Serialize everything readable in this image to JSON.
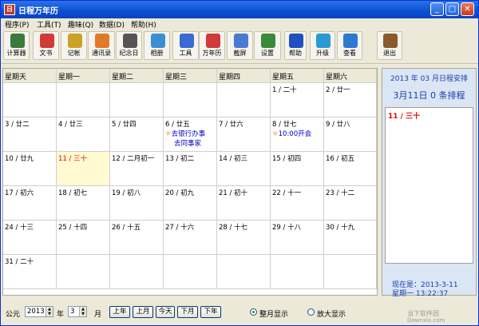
{
  "window": {
    "title": "日程万年历"
  },
  "menu": [
    "程序(P)",
    "工具(T)",
    "趣味(Q)",
    "数据(D)",
    "帮助(H)"
  ],
  "toolbar": [
    {
      "label": "计算器",
      "icon": "calculator-icon",
      "color": "#3a7a3a"
    },
    {
      "label": "文书",
      "icon": "document-icon",
      "color": "#d23a3a"
    },
    {
      "label": "记帐",
      "icon": "money-icon",
      "color": "#c9a227"
    },
    {
      "label": "通讯录",
      "icon": "addressbook-icon",
      "color": "#e07a2a"
    },
    {
      "label": "纪念日",
      "icon": "film-icon",
      "color": "#555555"
    },
    {
      "label": "相册",
      "icon": "photo-icon",
      "color": "#3a8fd2"
    },
    {
      "label": "工具",
      "icon": "magnifier-icon",
      "color": "#3a6ad2"
    },
    {
      "label": "万年历",
      "icon": "calendar-icon",
      "color": "#d23a3a"
    },
    {
      "label": "截屏",
      "icon": "screenshot-icon",
      "color": "#4a7ad2"
    },
    {
      "label": "设置",
      "icon": "settings-icon",
      "color": "#3a8a3a"
    },
    {
      "label": "帮助",
      "icon": "help-icon",
      "color": "#2050c0"
    },
    {
      "label": "升级",
      "icon": "upgrade-icon",
      "color": "#2a9ad2"
    },
    {
      "label": "查看",
      "icon": "globe-icon",
      "color": "#2a7ad2"
    },
    {
      "label": "退出",
      "icon": "exit-icon",
      "color": "#8a5a2a"
    }
  ],
  "weekdays": [
    "星期天",
    "星期一",
    "星期二",
    "星期三",
    "星期四",
    "星期五",
    "星期六"
  ],
  "weeks": [
    [
      "",
      "",
      "",
      "",
      "",
      "1 / 二十",
      "2 / 廿一"
    ],
    [
      "3 / 廿二",
      "4 / 廿三",
      "5 / 廿四",
      "6 / 廿五",
      "7 / 廿六",
      "8 / 廿七",
      "9 / 廿八"
    ],
    [
      "10 / 廿九",
      "11 / 三十",
      "12 / 二月初一",
      "13 / 初二",
      "14 / 初三",
      "15 / 初四",
      "16 / 初五"
    ],
    [
      "17 / 初六",
      "18 / 初七",
      "19 / 初八",
      "20 / 初九",
      "21 / 初十",
      "22 / 十一",
      "23 / 十二"
    ],
    [
      "24 / 十三",
      "25 / 十四",
      "26 / 十五",
      "27 / 十六",
      "28 / 十七",
      "29 / 十八",
      "30 / 十九"
    ],
    [
      "31 / 二十",
      "",
      "",
      "",
      "",
      "",
      ""
    ]
  ],
  "events": {
    "wed_week2": [
      "去银行办事",
      "去同事家"
    ],
    "fri_week2": [
      "10:00开会"
    ]
  },
  "today": "11 / 三十",
  "sidebar": {
    "header": "2013 年 03 月日程安排",
    "count": "3月11日 0 条排程",
    "selected": "11 / 三十",
    "now_label": "现在是：2013-3-11",
    "now_time": "星期一   13:22:37"
  },
  "bottom": {
    "era": "公元",
    "year": "2013",
    "year_unit": "年",
    "month": "3",
    "month_unit": "月",
    "buttons": [
      "上年",
      "上月",
      "今天",
      "下月",
      "下年"
    ],
    "radio1": "整月显示",
    "radio2": "放大显示"
  },
  "watermark": {
    "line1": "当下软件园",
    "line2": "Downxia.com"
  }
}
